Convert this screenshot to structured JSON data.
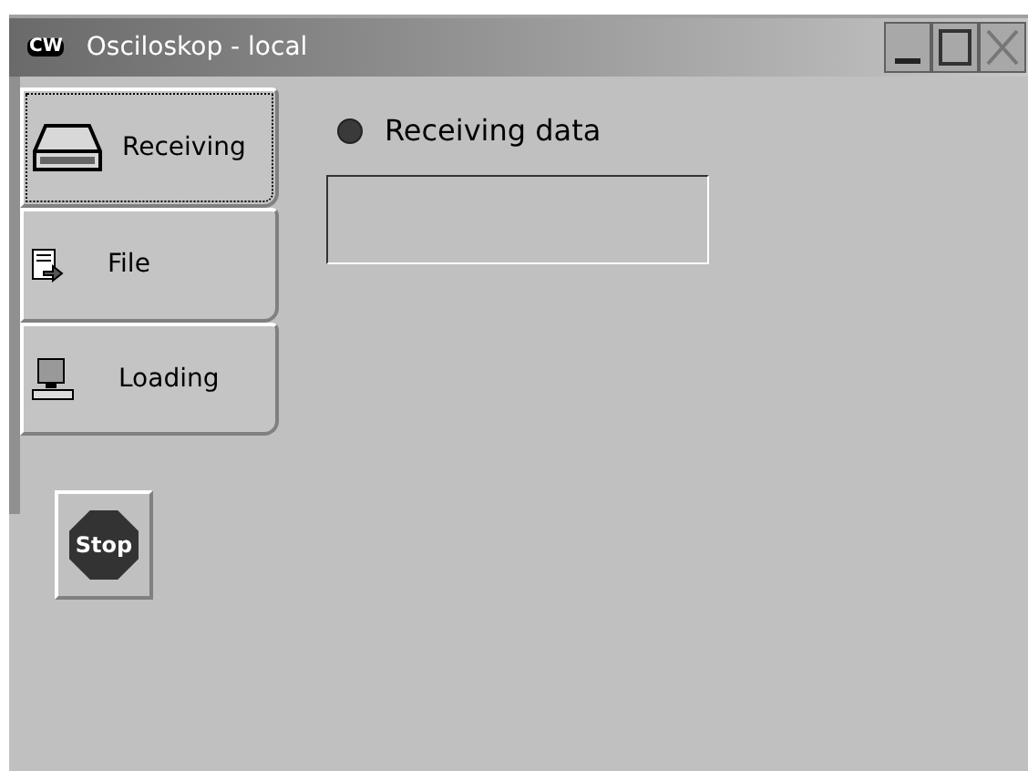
{
  "window": {
    "title": "Osciloskop - local",
    "icon_text": "CW"
  },
  "tabs": [
    {
      "label": "Receiving",
      "kind": "drive",
      "selected": true
    },
    {
      "label": "File",
      "kind": "file",
      "selected": false
    },
    {
      "label": "Loading",
      "kind": "computer",
      "selected": false
    }
  ],
  "indicator": {
    "label": "Receiving data",
    "on": false
  },
  "stop_button": {
    "label": "Stop"
  }
}
